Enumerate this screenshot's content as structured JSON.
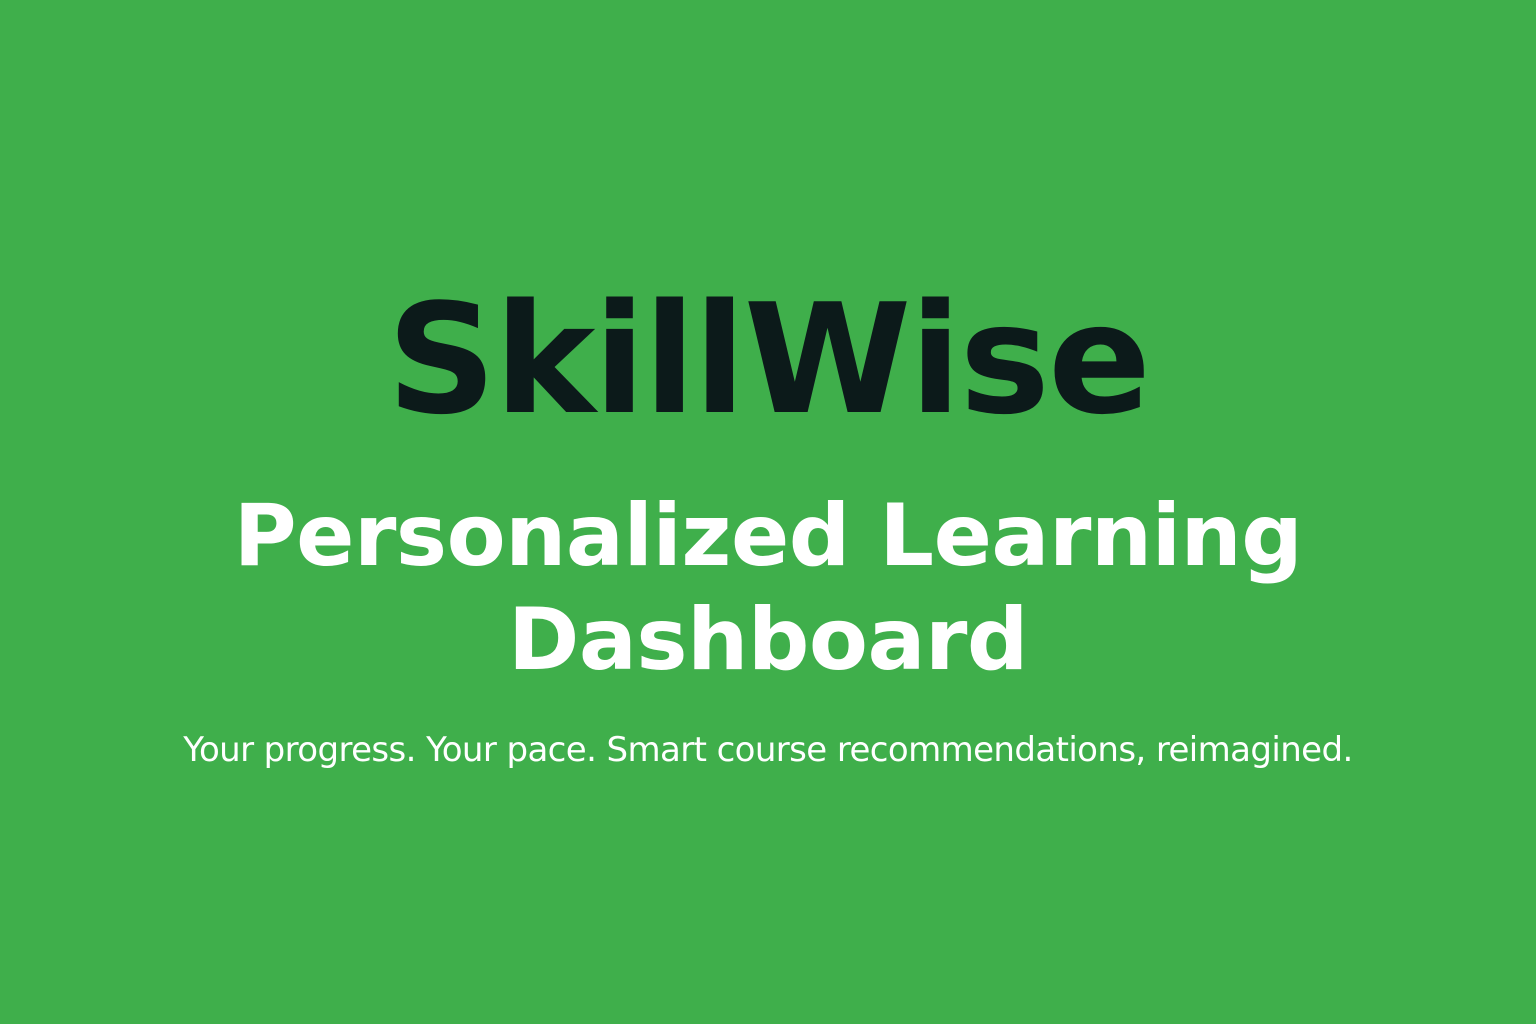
{
  "colors": {
    "background": "#3faf4b",
    "brand_text": "#0c1a1a",
    "headline_text": "#ffffff",
    "tagline_text": "#ffffff"
  },
  "hero": {
    "brand": "SkillWise",
    "headline_line1": "Personalized Learning",
    "headline_line2": "Dashboard",
    "tagline": "Your progress. Your pace. Smart course recommendations, reimagined."
  }
}
